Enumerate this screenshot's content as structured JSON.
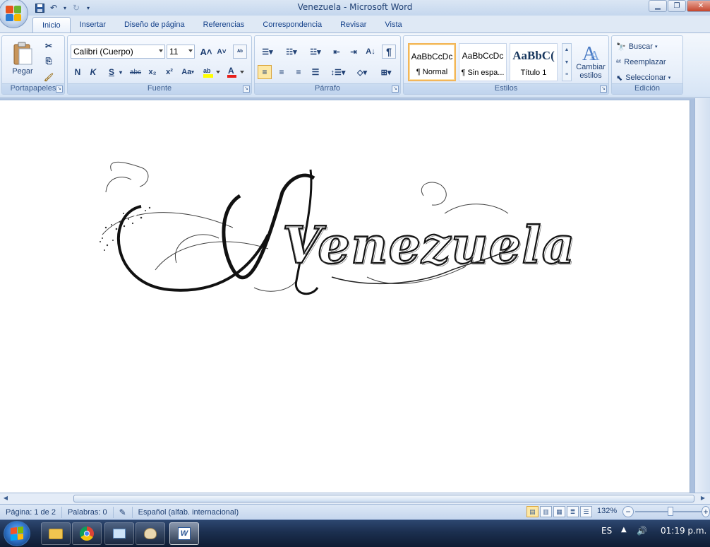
{
  "window": {
    "title": "Venezuela - Microsoft Word"
  },
  "ribbon": {
    "tabs": [
      "Inicio",
      "Insertar",
      "Diseño de página",
      "Referencias",
      "Correspondencia",
      "Revisar",
      "Vista"
    ],
    "groups": {
      "clipboard": "Portapapeles",
      "font": "Fuente",
      "paragraph": "Párrafo",
      "styles": "Estilos",
      "editing": "Edición"
    },
    "paste_label": "Pegar",
    "font_name": "Calibri (Cuerpo)",
    "font_size": "11",
    "bold_label": "N",
    "italic_label": "K",
    "underline_label": "S",
    "strike_label": "abc",
    "subscript_label": "x₂",
    "superscript_label": "x²",
    "case_label": "Aa",
    "styles": [
      {
        "sample": "AaBbCcDc",
        "name": "¶ Normal"
      },
      {
        "sample": "AaBbCcDc",
        "name": "¶ Sin espa..."
      },
      {
        "sample": "AaBbC(",
        "name": "Título 1"
      }
    ],
    "change_styles_label": "Cambiar estilos",
    "find_label": "Buscar",
    "replace_label": "Reemplazar",
    "select_label": "Seleccionar"
  },
  "document": {
    "artwork_text": "Venezuela"
  },
  "statusbar": {
    "page": "Página: 1 de 2",
    "words": "Palabras: 0",
    "language": "Español (alfab. internacional)",
    "zoom": "132%"
  },
  "taskbar": {
    "language": "ES",
    "time": "01:19 p.m."
  }
}
